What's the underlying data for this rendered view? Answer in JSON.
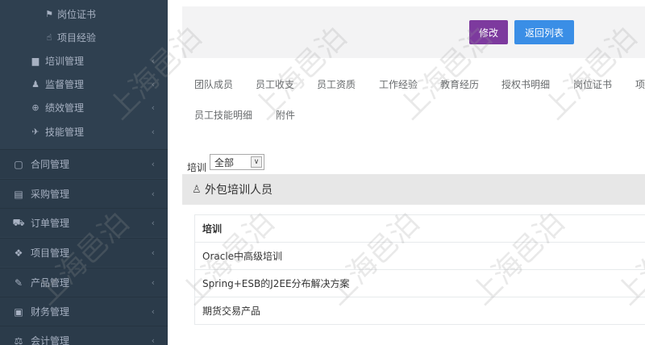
{
  "sidebar": {
    "sub_items": [
      {
        "label": "岗位证书",
        "icon": "flag-icon"
      },
      {
        "label": "项目经验",
        "icon": "hand-pointer-icon"
      }
    ],
    "menu_items": [
      {
        "label": "培训管理",
        "icon": "briefcase-icon"
      },
      {
        "label": "监督管理",
        "icon": "user-icon"
      },
      {
        "label": "绩效管理",
        "icon": "globe-icon"
      },
      {
        "label": "技能管理",
        "icon": "plane-icon"
      }
    ],
    "groups": [
      {
        "label": "合同管理",
        "icon": "file-icon"
      },
      {
        "label": "采购管理",
        "icon": "list-icon"
      },
      {
        "label": "订单管理",
        "icon": "cart-icon"
      },
      {
        "label": "项目管理",
        "icon": "cubes-icon"
      },
      {
        "label": "产品管理",
        "icon": "edit-icon"
      },
      {
        "label": "财务管理",
        "icon": "money-icon"
      },
      {
        "label": "会计管理",
        "icon": "balance-icon"
      }
    ]
  },
  "toolbar": {
    "edit_label": "修改",
    "back_label": "返回列表"
  },
  "tabs": [
    "团队成员",
    "员工收支",
    "员工资质",
    "工作经验",
    "教育经历",
    "授权书明细",
    "岗位证书",
    "项",
    "员工技能明细",
    "附件"
  ],
  "filter": {
    "label": "培训",
    "selected": "全部"
  },
  "panel": {
    "title": "外包培训人员"
  },
  "table": {
    "header": "培训",
    "rows": [
      "Oracle中高级培训",
      "Spring+ESB的J2EE分布解决方案",
      "期货交易产品"
    ]
  },
  "watermark": "上海邑泊",
  "colors": {
    "sidebar_bg": "#2f4050",
    "edit_button": "#7d3a9e",
    "back_button": "#3a8ee6"
  }
}
